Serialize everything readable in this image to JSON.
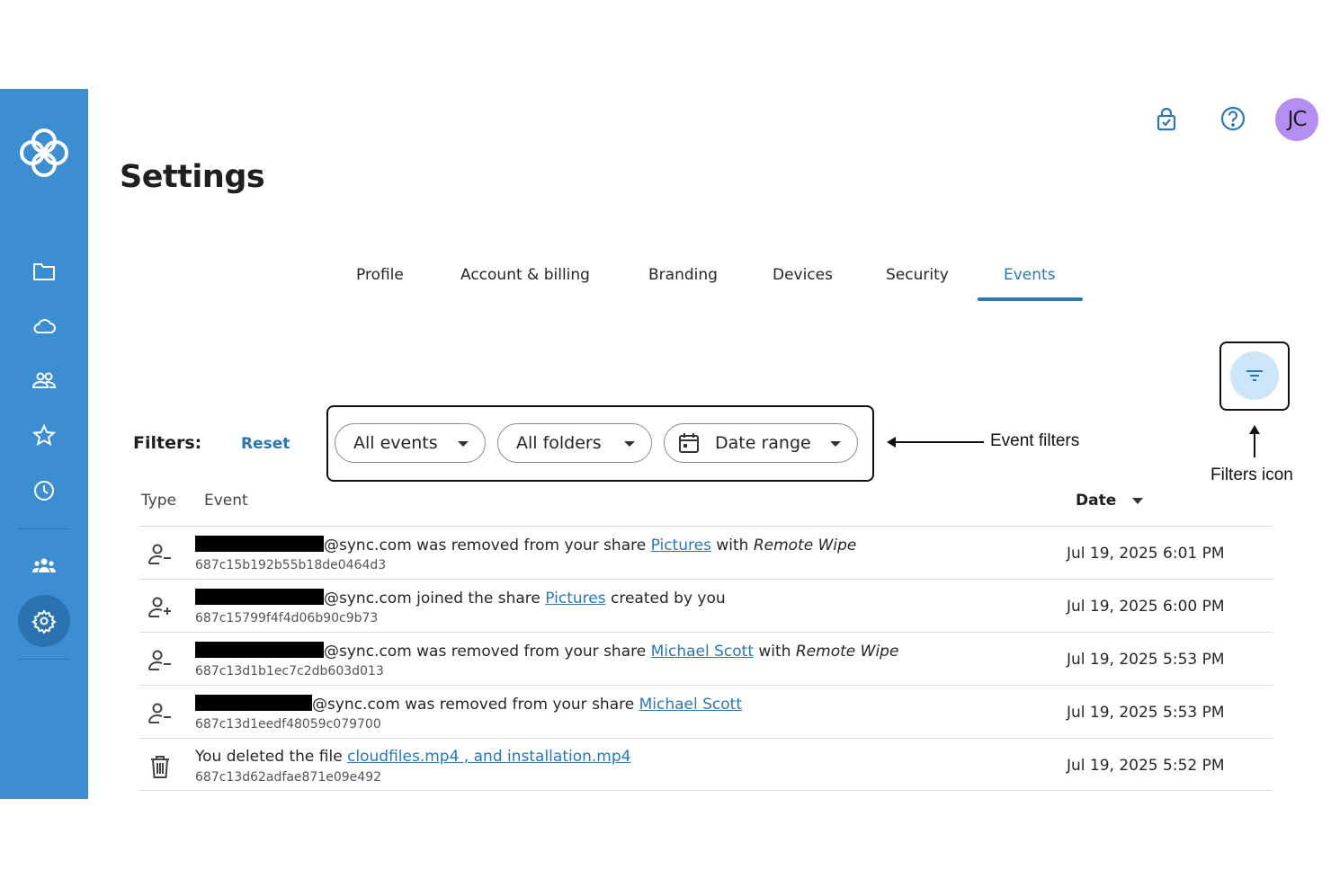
{
  "header": {
    "title": "Settings",
    "avatar_initials": "JC"
  },
  "tabs": [
    {
      "label": "Profile",
      "active": false
    },
    {
      "label": "Account & billing",
      "active": false
    },
    {
      "label": "Branding",
      "active": false
    },
    {
      "label": "Devices",
      "active": false
    },
    {
      "label": "Security",
      "active": false
    },
    {
      "label": "Events",
      "active": true
    }
  ],
  "filters": {
    "label": "Filters:",
    "reset": "Reset",
    "event_type": "All events",
    "folder": "All folders",
    "date_range": "Date range"
  },
  "annotations": {
    "event_filters": "Event filters",
    "filters_icon": "Filters icon"
  },
  "table": {
    "columns": {
      "type": "Type",
      "event": "Event",
      "date": "Date"
    },
    "rows": [
      {
        "icon": "person-remove-icon",
        "text_before": "@sync.com was removed from your share ",
        "link": "Pictures",
        "text_after": " with ",
        "emphasis": "Remote Wipe",
        "id": "687c15b192b55b18de0464d3",
        "date": "Jul 19, 2025 6:01 PM"
      },
      {
        "icon": "person-add-icon",
        "text_before": "@sync.com joined the share ",
        "link": "Pictures",
        "text_after": " created by you",
        "emphasis": "",
        "id": "687c15799f4f4d06b90c9b73",
        "date": "Jul 19, 2025 6:00 PM"
      },
      {
        "icon": "person-remove-icon",
        "text_before": "@sync.com was removed from your share ",
        "link": "Michael Scott",
        "text_after": " with ",
        "emphasis": "Remote Wipe",
        "id": "687c13d1b1ec7c2db603d013",
        "date": "Jul 19, 2025 5:53 PM"
      },
      {
        "icon": "person-remove-icon",
        "text_before": "@sync.com was removed from your share ",
        "link": "Michael Scott",
        "text_after": "",
        "emphasis": "",
        "id": "687c13d1eedf48059c079700",
        "date": "Jul 19, 2025 5:53 PM"
      },
      {
        "icon": "trash-icon",
        "text_before": "You deleted the file ",
        "link": "cloudfiles.mp4 , and installation.mp4",
        "text_after": "",
        "emphasis": "",
        "id": "687c13d62adfae871e09e492",
        "date": "Jul 19, 2025 5:52 PM"
      }
    ]
  },
  "colors": {
    "sidebar": "#3d8ed1",
    "accent": "#2a77b5",
    "avatar": "#b58ef2",
    "filter_button": "#cde5f8"
  }
}
